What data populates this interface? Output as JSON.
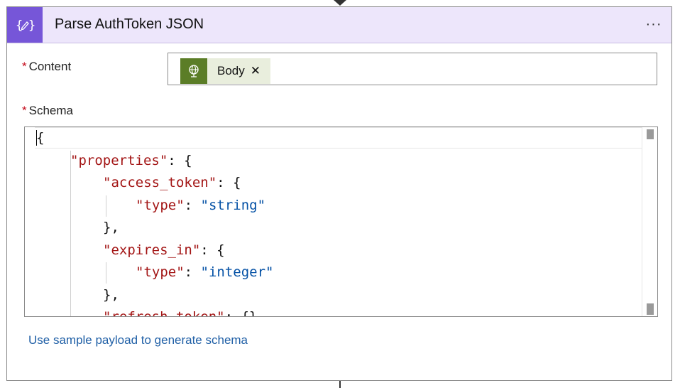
{
  "action": {
    "title": "Parse AuthToken JSON",
    "icon": "braces-edit-icon",
    "menu_label": "···",
    "accent": "#7656d8",
    "header_bg": "#ede6fb"
  },
  "content_field": {
    "required_mark": "*",
    "label": "Content",
    "token": {
      "label": "Body",
      "remove": "✕",
      "icon": "globe-icon",
      "color": "#5b7d27"
    }
  },
  "schema_field": {
    "required_mark": "*",
    "label": "Schema",
    "code_lines": [
      {
        "indent": 0,
        "key": "",
        "sep": "",
        "value": "",
        "tail": "{"
      },
      {
        "indent": 1,
        "key": "\"properties\"",
        "sep": ": ",
        "value": "",
        "tail": "{"
      },
      {
        "indent": 2,
        "key": "\"access_token\"",
        "sep": ": ",
        "value": "",
        "tail": "{"
      },
      {
        "indent": 3,
        "key": "\"type\"",
        "sep": ": ",
        "value": "\"string\"",
        "tail": ""
      },
      {
        "indent": 2,
        "key": "",
        "sep": "",
        "value": "",
        "tail": "},"
      },
      {
        "indent": 2,
        "key": "\"expires_in\"",
        "sep": ": ",
        "value": "",
        "tail": "{"
      },
      {
        "indent": 3,
        "key": "\"type\"",
        "sep": ": ",
        "value": "\"integer\"",
        "tail": ""
      },
      {
        "indent": 2,
        "key": "",
        "sep": "",
        "value": "",
        "tail": "},"
      },
      {
        "indent": 2,
        "key": "\"refresh_token\"",
        "sep": ": ",
        "value": "",
        "tail": "{}"
      }
    ]
  },
  "sample_payload_link": "Use sample payload to generate schema"
}
